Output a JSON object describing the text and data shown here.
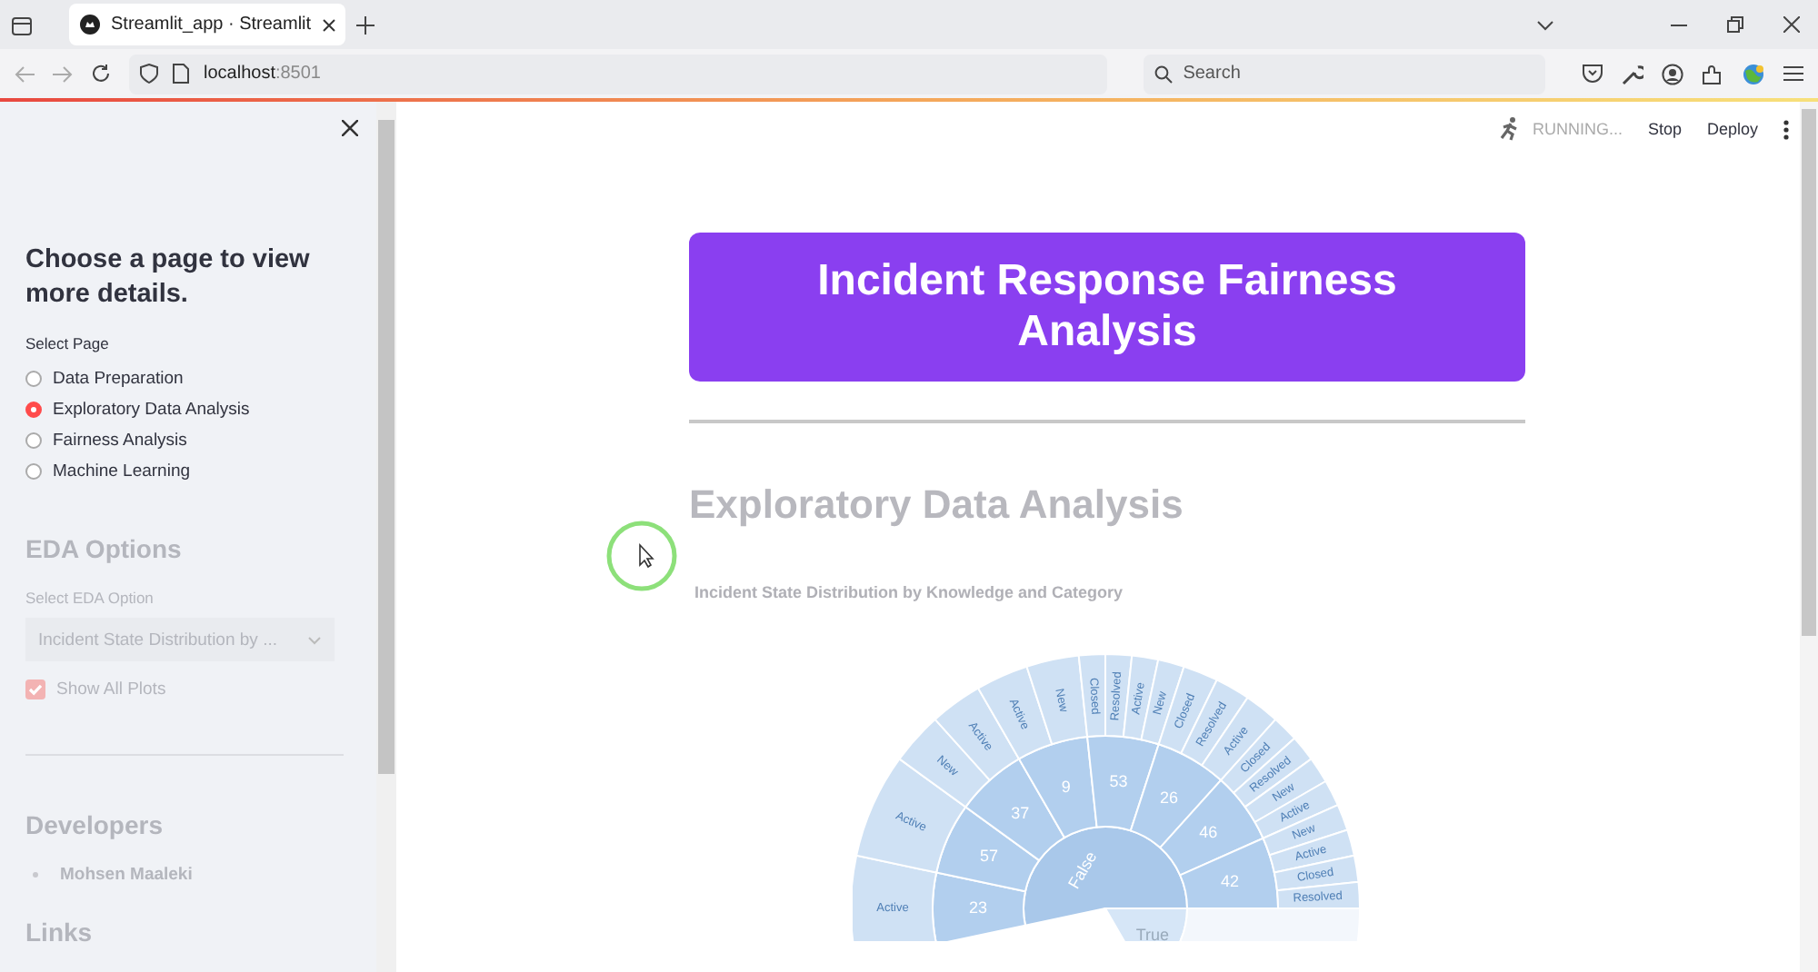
{
  "browser": {
    "tab_title": "Streamlit_app · Streamlit",
    "url_host": "localhost",
    "url_port": ":8501",
    "search_placeholder": "Search"
  },
  "sidebar": {
    "heading": "Choose a page to view more details.",
    "radio_label": "Select Page",
    "pages": [
      {
        "label": "Data Preparation",
        "selected": false
      },
      {
        "label": "Exploratory Data Analysis",
        "selected": true
      },
      {
        "label": "Fairness Analysis",
        "selected": false
      },
      {
        "label": "Machine Learning",
        "selected": false
      }
    ],
    "eda_heading": "EDA Options",
    "eda_select_label": "Select EDA Option",
    "eda_select_value": "Incident State Distribution by ...",
    "show_all_plots": {
      "label": "Show All Plots",
      "checked": true
    },
    "developers_heading": "Developers",
    "developers": [
      "Mohsen Maaleki"
    ],
    "links_heading": "Links"
  },
  "header": {
    "status": "RUNNING...",
    "stop": "Stop",
    "deploy": "Deploy"
  },
  "banner": "Incident Response Fairness Analysis",
  "page_heading": "Exploratory Data Analysis",
  "chart_title": "Incident State Distribution by Knowledge and Category",
  "sunburst": {
    "inner": [
      "False",
      "True"
    ],
    "middle": [
      {
        "label": "23",
        "outer": [
          "Active"
        ]
      },
      {
        "label": "57",
        "outer": [
          "Active"
        ]
      },
      {
        "label": "37",
        "outer": [
          "New",
          "Active"
        ]
      },
      {
        "label": "9",
        "outer": [
          "Active",
          "New"
        ]
      },
      {
        "label": "53",
        "outer": [
          "Closed",
          "Resolved",
          "Active",
          "New"
        ]
      },
      {
        "label": "26",
        "outer": [
          "Closed",
          "Resolved",
          "Active"
        ]
      },
      {
        "label": "46",
        "outer": [
          "Closed",
          "Resolved",
          "New",
          "Active"
        ]
      },
      {
        "label": "42",
        "outer": [
          "New",
          "Active",
          "Closed",
          "Resolved"
        ]
      }
    ]
  }
}
